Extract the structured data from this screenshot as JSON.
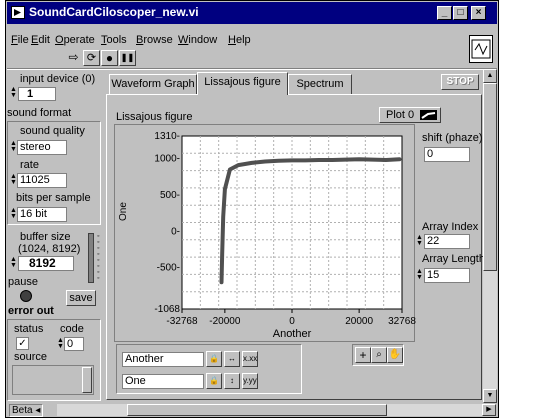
{
  "window": {
    "title": "SoundCardCiloscoper_new.vi",
    "min_glyph": "_",
    "max_glyph": "□",
    "close_glyph": "×"
  },
  "menu": [
    "File",
    "Edit",
    "Operate",
    "Tools",
    "Browse",
    "Window",
    "Help"
  ],
  "toolbar": {
    "run_glyph": "⇨",
    "continuous_glyph": "⟳",
    "abort_glyph": "●",
    "pause_glyph": "❚❚"
  },
  "left": {
    "input_device_label": "input device (0)",
    "input_device_value": "1",
    "sound_format_label": "sound format",
    "sound_quality_label": "sound quality",
    "sound_quality_value": "stereo",
    "rate_label": "rate",
    "rate_value": "11025",
    "bits_label": "bits per sample",
    "bits_value": "16 bit",
    "buffer_label": "buffer size",
    "buffer_range": "(1024, 8192)",
    "buffer_value": "8192",
    "pause_label": "pause",
    "save_label": "save",
    "error_out_label": "error out",
    "status_label": "status",
    "code_label": "code",
    "code_value": "0",
    "source_label": "source",
    "status_check_glyph": "✓"
  },
  "tabs": [
    "Waveform Graph",
    "Lissajous figure",
    "Spectrum"
  ],
  "stop_label": "STOP",
  "graph": {
    "title": "Lissajous figure",
    "plot_label": "Plot 0",
    "xlabel": "Another",
    "ylabel": "One",
    "x_ticks": [
      "-32768",
      "-20000",
      "0",
      "20000",
      "32768"
    ],
    "y_ticks": [
      "1310-",
      "1000-",
      "500-",
      "0-",
      "-500-",
      "-1068"
    ],
    "legend_x_name": "Another",
    "legend_y_name": "One"
  },
  "right": {
    "shift_label": "shift (phaze)",
    "shift_value": "0",
    "array_index_label": "Array Index",
    "array_index_value": "22",
    "array_length_label": "Array Length",
    "array_length_value": "15"
  },
  "statusbar": {
    "text": "Beta"
  },
  "chart_data": {
    "type": "line",
    "title": "Lissajous figure",
    "xlabel": "Another",
    "ylabel": "One",
    "xlim": [
      -32768,
      32768
    ],
    "ylim": [
      -1068,
      1310
    ],
    "grid": true,
    "series": [
      {
        "name": "Plot 0",
        "x": [
          -21000,
          -20800,
          -20500,
          -20000,
          -18500,
          -16000,
          -12000,
          -8000,
          -4000,
          0,
          4000,
          8000,
          12000,
          16000,
          20000,
          24000,
          28000,
          32000
        ],
        "y": [
          -700,
          -300,
          200,
          580,
          850,
          910,
          940,
          960,
          970,
          975,
          975,
          980,
          980,
          985,
          990,
          985,
          980,
          990
        ]
      }
    ]
  }
}
